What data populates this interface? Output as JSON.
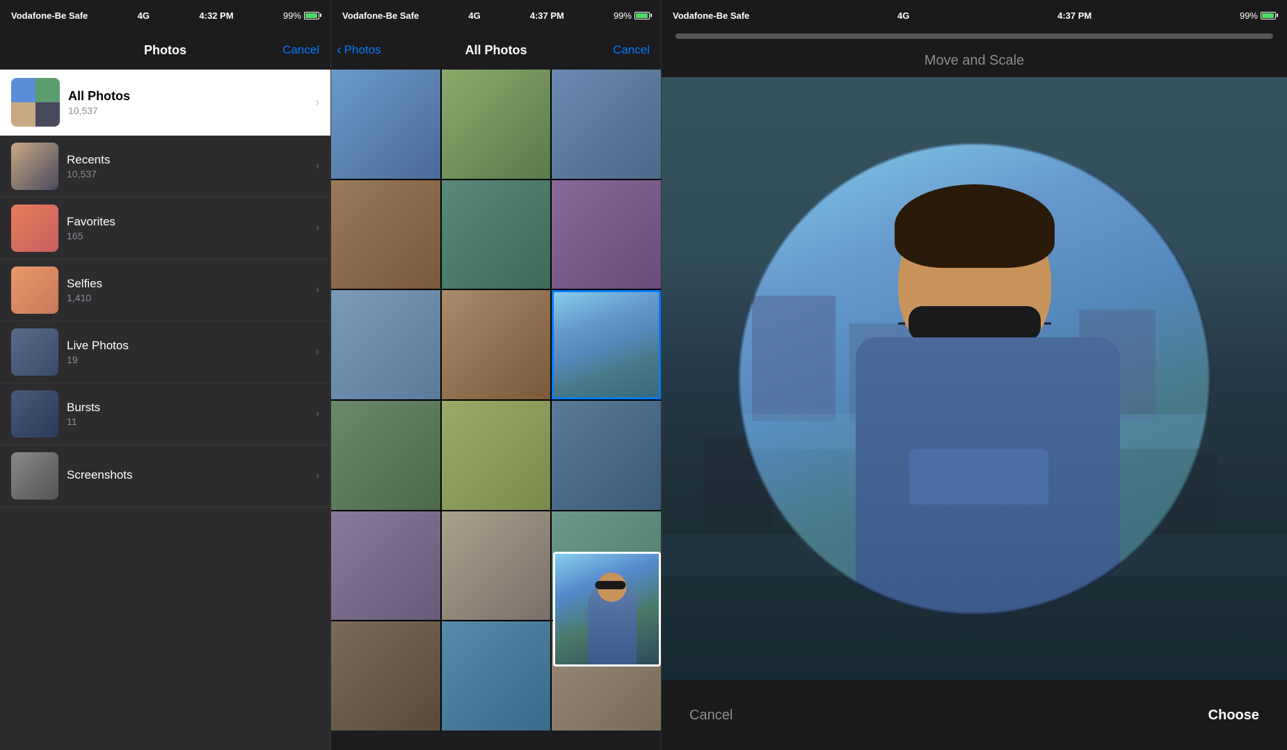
{
  "panel1": {
    "status_bar": {
      "carrier": "Vodafone-Be Safe",
      "network": "4G",
      "time": "4:32 PM",
      "battery": "99%"
    },
    "nav": {
      "title": "Photos",
      "cancel_label": "Cancel"
    },
    "all_photos_album": {
      "name": "All Photos",
      "count": "10,537"
    },
    "albums": [
      {
        "name": "Recents",
        "count": "10,537"
      },
      {
        "name": "Favorites",
        "count": "165"
      },
      {
        "name": "Selfies",
        "count": "1,410"
      },
      {
        "name": "Live Photos",
        "count": "19"
      },
      {
        "name": "Bursts",
        "count": "11"
      },
      {
        "name": "Screenshots",
        "count": ""
      }
    ]
  },
  "panel2": {
    "status_bar": {
      "carrier": "Vodafone-Be Safe",
      "network": "4G",
      "time": "4:37 PM",
      "battery": "99%"
    },
    "nav": {
      "back_label": "Photos",
      "title": "All Photos",
      "cancel_label": "Cancel"
    }
  },
  "panel3": {
    "status_bar": {
      "carrier": "Vodafone-Be Safe",
      "network": "4G",
      "time": "4:37 PM",
      "battery": "99%"
    },
    "title": "Move and Scale",
    "cancel_label": "Cancel",
    "choose_label": "Choose"
  }
}
